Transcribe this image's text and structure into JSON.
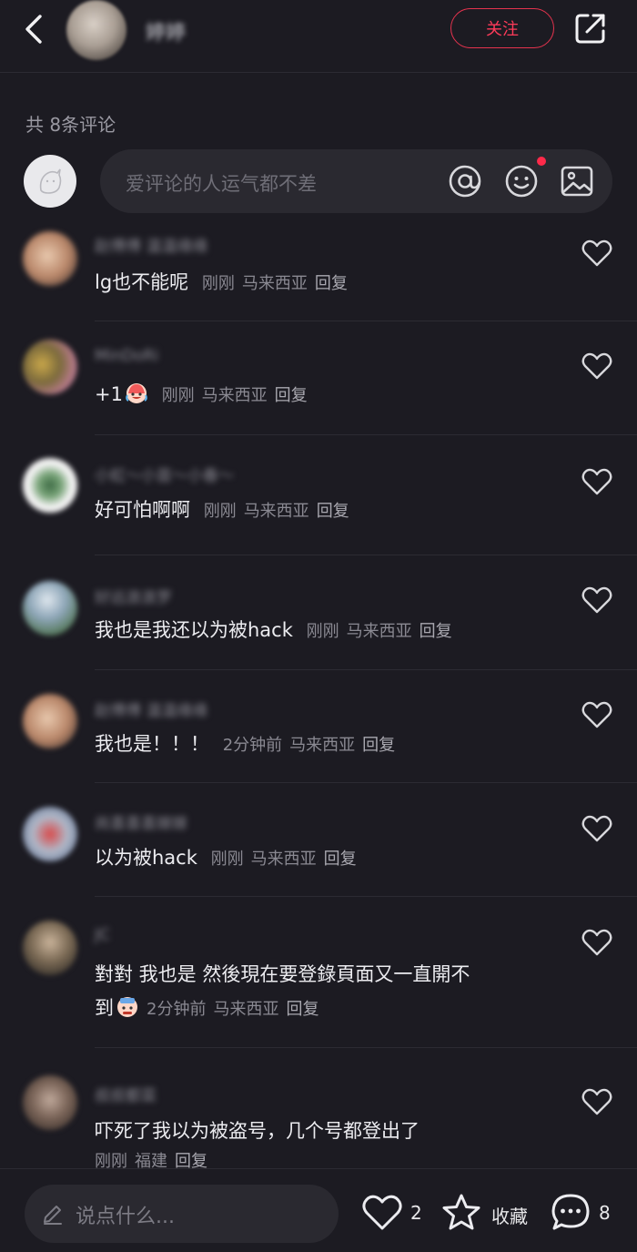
{
  "header": {
    "author_name": "婷婷",
    "follow_label": "关注"
  },
  "comments_header": {
    "count_label": "共 8条评论"
  },
  "composer": {
    "placeholder": "爱评论的人运气都不差"
  },
  "comments": [
    {
      "username": "赵傅傅 温温缘缘",
      "text": "lg也不能呢",
      "time": "刚刚",
      "location": "马来西亚",
      "reply": "回复"
    },
    {
      "username": "MinDoRi",
      "text": "+1",
      "time": "刚刚",
      "location": "马来西亚",
      "reply": "回复"
    },
    {
      "username": "小虹～小苗～小春～",
      "text": "好可怕啊啊",
      "time": "刚刚",
      "location": "马来西亚",
      "reply": "回复"
    },
    {
      "username": "好远浪浪罗",
      "text": "我也是我还以为被hack",
      "time": "刚刚",
      "location": "马来西亚",
      "reply": "回复"
    },
    {
      "username": "赵傅傅 温温缘缘",
      "text": "我也是！！！",
      "time": "2分钟前",
      "location": "马来西亚",
      "reply": "回复"
    },
    {
      "username": "尚喜喜喜嫁嫁",
      "text": "以为被hack",
      "time": "刚刚",
      "location": "马来西亚",
      "reply": "回复"
    },
    {
      "username": "JC",
      "text_line1": "對對 我也是 然後現在要登錄頁面又一直開不",
      "text_line2": "到",
      "time": "2分钟前",
      "location": "马来西亚",
      "reply": "回复"
    },
    {
      "username": "叔叔都菜",
      "text": "吓死了我以为被盗号，几个号都登出了",
      "time": "刚刚",
      "location": "福建",
      "reply": "回复"
    }
  ],
  "bottom_bar": {
    "input_placeholder": "说点什么...",
    "like_count": "2",
    "favorite_label": "收藏",
    "comment_count": "8"
  },
  "colors": {
    "background": "#1c1b22",
    "accent": "#ff3b5a",
    "input_bg": "#2a2930"
  }
}
